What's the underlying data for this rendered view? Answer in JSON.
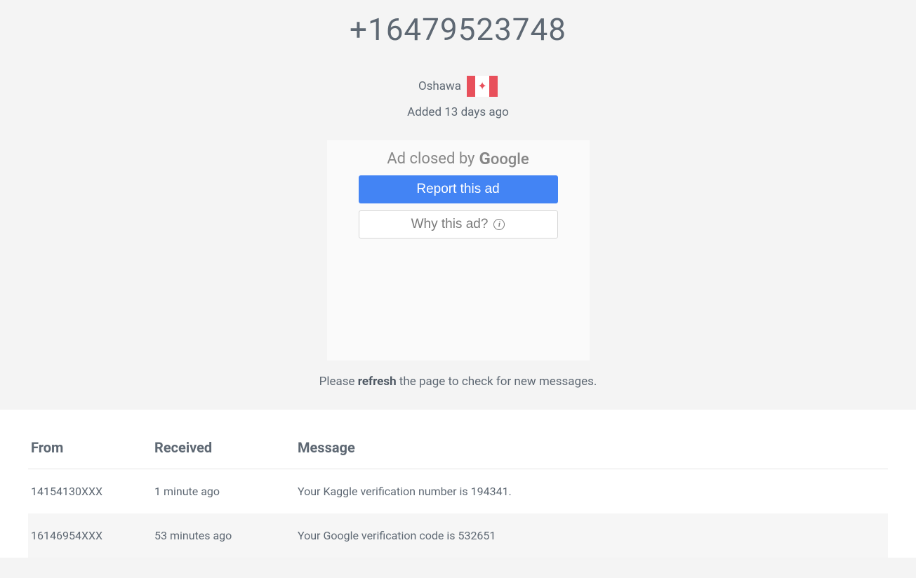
{
  "phone_number": "+16479523748",
  "location": "Oshawa",
  "added_text": "Added 13 days ago",
  "ad": {
    "closed_by": "Ad closed by",
    "google_text": "Google",
    "report_label": "Report this ad",
    "why_label": "Why this ad?"
  },
  "refresh": {
    "prefix": "Please ",
    "bold": "refresh",
    "suffix": " the page to check for new messages."
  },
  "columns": {
    "from": "From",
    "received": "Received",
    "message": "Message"
  },
  "messages": [
    {
      "from": "14154130XXX",
      "received": "1 minute ago",
      "message": "Your Kaggle verification number is 194341."
    },
    {
      "from": "16146954XXX",
      "received": "53 minutes ago",
      "message": "Your Google verification code is 532651"
    }
  ]
}
